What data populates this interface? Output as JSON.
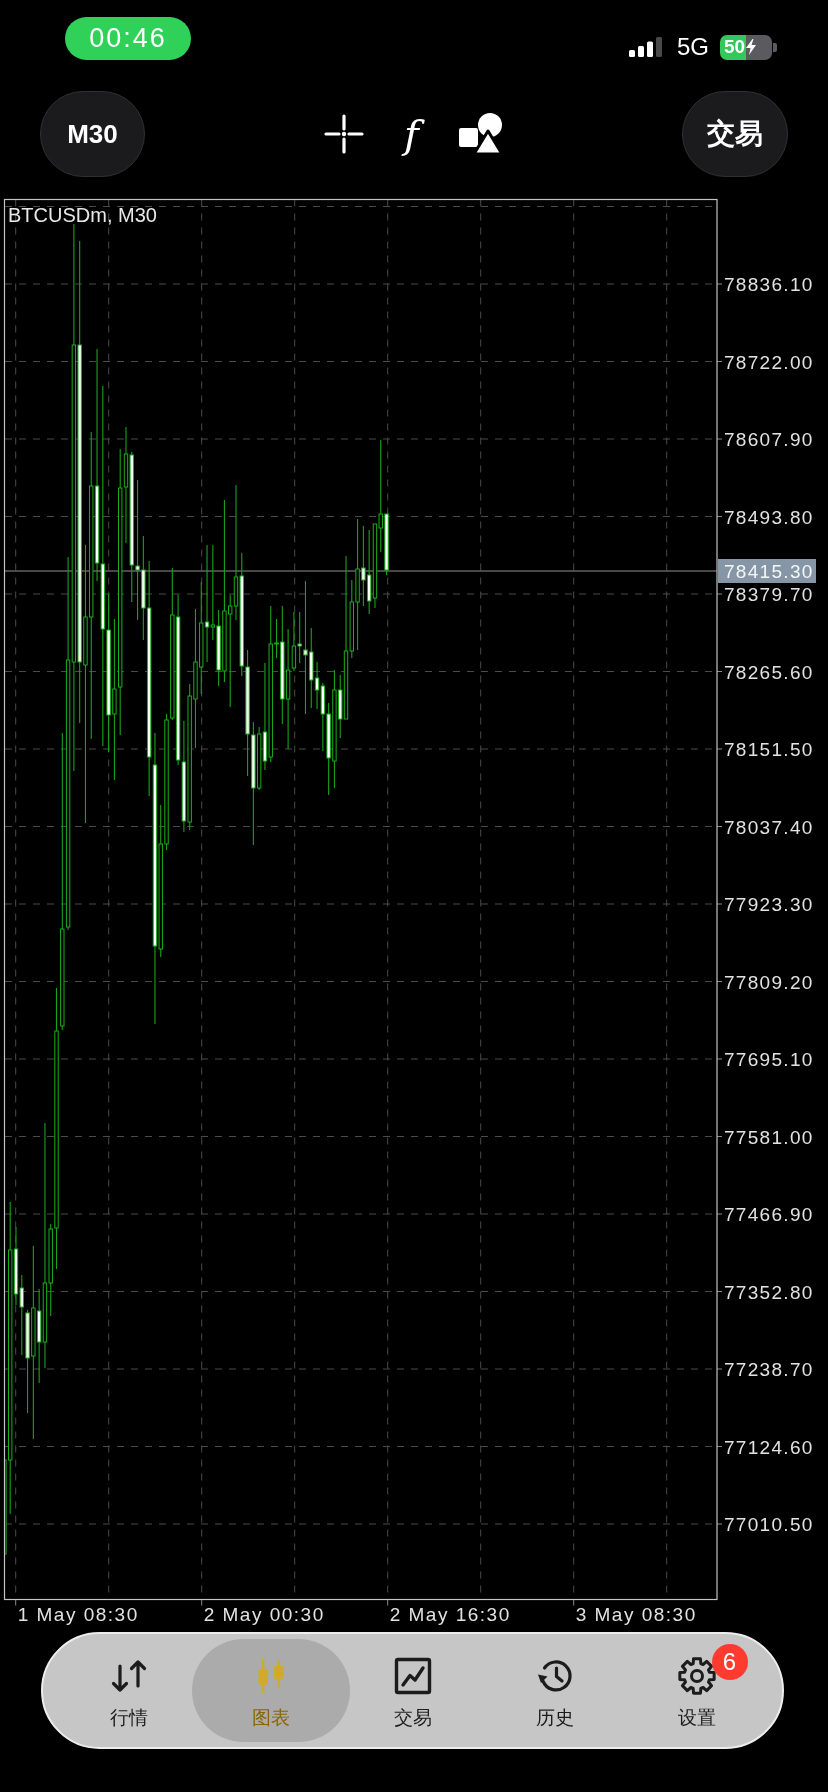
{
  "status_bar": {
    "time": "00:46",
    "network": "5G",
    "battery": "50"
  },
  "toolbar": {
    "timeframe": "M30",
    "tools": [
      {
        "kind": "crosshair"
      },
      {
        "kind": "function",
        "label": "f"
      },
      {
        "kind": "shapes"
      }
    ],
    "trade_button": "交易"
  },
  "chart": {
    "symbol": "BTCUSDm, M30",
    "price_labels": [
      "78836.10",
      "78722.00",
      "78607.90",
      "78493.80",
      "78379.70",
      "78265.60",
      "78151.50",
      "78037.40",
      "77923.30",
      "77809.20",
      "77695.10",
      "77581.00",
      "77466.90",
      "77352.80",
      "77238.70",
      "77124.60",
      "77010.50"
    ],
    "current_price": "78415.30",
    "time_labels": [
      "1 May 08:30",
      "2 May 00:30",
      "2 May 16:30",
      "3 May 08:30"
    ]
  },
  "tab_bar": {
    "tabs": [
      {
        "kind": "quotes",
        "label": "行情",
        "selected": false
      },
      {
        "kind": "chart",
        "label": "图表",
        "selected": true
      },
      {
        "kind": "trade",
        "label": "交易",
        "selected": false
      },
      {
        "kind": "history",
        "label": "历史",
        "selected": false
      },
      {
        "kind": "settings",
        "label": "设置",
        "selected": false,
        "badge": "6"
      }
    ]
  }
}
